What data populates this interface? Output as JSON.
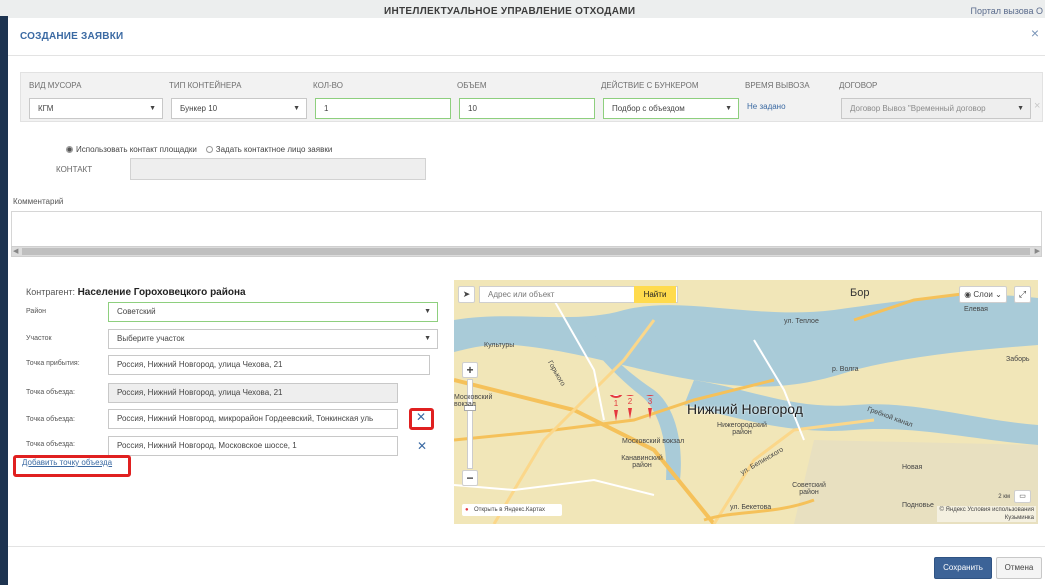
{
  "backdrop": {
    "title": "ИНТЕЛЛЕКТУАЛЬНОЕ УПРАВЛЕНИЕ ОТХОДАМИ",
    "top_link": "Портал вызова О"
  },
  "modal": {
    "title": "СОЗДАНИЕ ЗАЯВКИ",
    "close_glyph": "×"
  },
  "table": {
    "headers": [
      "ВИД МУСОРА",
      "ТИП КОНТЕЙНЕРА",
      "КОЛ-ВО",
      "ОБЪЕМ",
      "ДЕЙСТВИЕ С БУНКЕРОМ",
      "ВРЕМЯ ВЫВОЗА",
      "ДОГОВОР"
    ],
    "row": {
      "waste_type": "КГМ",
      "container_type": "Бункер 10",
      "quantity": "1",
      "volume": "10",
      "bunker_action": "Подбор с объездом",
      "pickup_time": "Не задано",
      "contract": "Договор Вывоз \"Временный договор"
    }
  },
  "contact": {
    "option_site": "Использовать контакт площадки",
    "option_custom": "Задать контактное лицо заявки",
    "label": "КОНТАКТ"
  },
  "comment": {
    "label": "Комментарий"
  },
  "form": {
    "counterparty_label": "Контрагент:",
    "counterparty_value": "Население Гороховецкого района",
    "district_label": "Район",
    "district_value": "Советский",
    "section_label": "Участок",
    "section_value": "Выберите участок",
    "arrival_label": "Точка прибытия:",
    "arrival_value": "Россия, Нижний Новгород, улица Чехова, 21",
    "detour_label": "Точка объезда:",
    "detour_1": "Россия, Нижний Новгород, улица Чехова, 21",
    "detour_2": "Россия, Нижний Новгород, микрорайон Гордеевский, Тонкинская уль",
    "detour_3": "Россия, Нижний Новгород, Московское шоссе, 1",
    "add_point": "Добавить точку объезда"
  },
  "map": {
    "search_placeholder": "Адрес или объект",
    "find_button": "Найти",
    "layers": "Слои",
    "city_label": "Нижний Новгород",
    "places": {
      "bor": "Бор",
      "elevaya": "Елевая",
      "zabore": "Заборь",
      "novaya": "Новая",
      "podnovye": "Подновье",
      "kuzminka": "Кузьминка",
      "sovetsky": "Советский район",
      "nizhegorodsky": "Нижегородский район",
      "kanavinsky": "Канавинский район",
      "moskovsky": "Московский вокзал",
      "moskovsky_left": "Московский вокзал",
      "kultury": "Культуры",
      "belinskogo": "ул. Белинского",
      "beketova": "ул. Бекетова",
      "gorkogo": "Горького",
      "volga": "р. Волга",
      "teplovoe": "ул. Теплое",
      "grebnoy": "Гребной канал"
    },
    "markers": [
      "1",
      "2",
      "3"
    ],
    "open_in_yandex": "Открыть в Яндекс.Картах",
    "scale": "2 км",
    "copyright_1": "© Яндекс Условия использования",
    "copyright_2": "Кузьминка"
  },
  "footer": {
    "save": "Сохранить",
    "cancel": "Отмена"
  },
  "colors": {
    "accent": "#3b6aa3",
    "highlight": "#e02020",
    "save_bg": "#3c6397"
  }
}
